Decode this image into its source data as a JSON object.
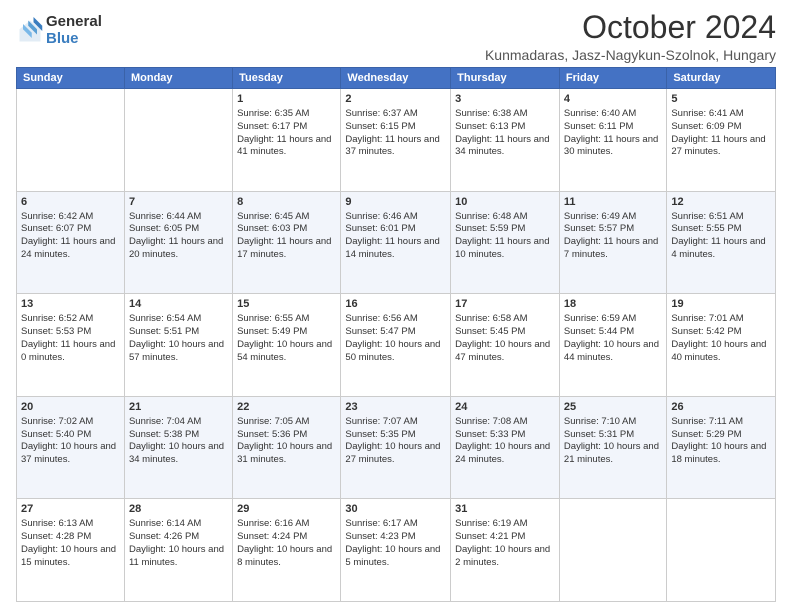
{
  "header": {
    "logo": {
      "general": "General",
      "blue": "Blue"
    },
    "title": "October 2024",
    "subtitle": "Kunmadaras, Jasz-Nagykun-Szolnok, Hungary"
  },
  "weekdays": [
    "Sunday",
    "Monday",
    "Tuesday",
    "Wednesday",
    "Thursday",
    "Friday",
    "Saturday"
  ],
  "weeks": [
    [
      {
        "day": "",
        "sunrise": "",
        "sunset": "",
        "daylight": ""
      },
      {
        "day": "",
        "sunrise": "",
        "sunset": "",
        "daylight": ""
      },
      {
        "day": "1",
        "sunrise": "Sunrise: 6:35 AM",
        "sunset": "Sunset: 6:17 PM",
        "daylight": "Daylight: 11 hours and 41 minutes."
      },
      {
        "day": "2",
        "sunrise": "Sunrise: 6:37 AM",
        "sunset": "Sunset: 6:15 PM",
        "daylight": "Daylight: 11 hours and 37 minutes."
      },
      {
        "day": "3",
        "sunrise": "Sunrise: 6:38 AM",
        "sunset": "Sunset: 6:13 PM",
        "daylight": "Daylight: 11 hours and 34 minutes."
      },
      {
        "day": "4",
        "sunrise": "Sunrise: 6:40 AM",
        "sunset": "Sunset: 6:11 PM",
        "daylight": "Daylight: 11 hours and 30 minutes."
      },
      {
        "day": "5",
        "sunrise": "Sunrise: 6:41 AM",
        "sunset": "Sunset: 6:09 PM",
        "daylight": "Daylight: 11 hours and 27 minutes."
      }
    ],
    [
      {
        "day": "6",
        "sunrise": "Sunrise: 6:42 AM",
        "sunset": "Sunset: 6:07 PM",
        "daylight": "Daylight: 11 hours and 24 minutes."
      },
      {
        "day": "7",
        "sunrise": "Sunrise: 6:44 AM",
        "sunset": "Sunset: 6:05 PM",
        "daylight": "Daylight: 11 hours and 20 minutes."
      },
      {
        "day": "8",
        "sunrise": "Sunrise: 6:45 AM",
        "sunset": "Sunset: 6:03 PM",
        "daylight": "Daylight: 11 hours and 17 minutes."
      },
      {
        "day": "9",
        "sunrise": "Sunrise: 6:46 AM",
        "sunset": "Sunset: 6:01 PM",
        "daylight": "Daylight: 11 hours and 14 minutes."
      },
      {
        "day": "10",
        "sunrise": "Sunrise: 6:48 AM",
        "sunset": "Sunset: 5:59 PM",
        "daylight": "Daylight: 11 hours and 10 minutes."
      },
      {
        "day": "11",
        "sunrise": "Sunrise: 6:49 AM",
        "sunset": "Sunset: 5:57 PM",
        "daylight": "Daylight: 11 hours and 7 minutes."
      },
      {
        "day": "12",
        "sunrise": "Sunrise: 6:51 AM",
        "sunset": "Sunset: 5:55 PM",
        "daylight": "Daylight: 11 hours and 4 minutes."
      }
    ],
    [
      {
        "day": "13",
        "sunrise": "Sunrise: 6:52 AM",
        "sunset": "Sunset: 5:53 PM",
        "daylight": "Daylight: 11 hours and 0 minutes."
      },
      {
        "day": "14",
        "sunrise": "Sunrise: 6:54 AM",
        "sunset": "Sunset: 5:51 PM",
        "daylight": "Daylight: 10 hours and 57 minutes."
      },
      {
        "day": "15",
        "sunrise": "Sunrise: 6:55 AM",
        "sunset": "Sunset: 5:49 PM",
        "daylight": "Daylight: 10 hours and 54 minutes."
      },
      {
        "day": "16",
        "sunrise": "Sunrise: 6:56 AM",
        "sunset": "Sunset: 5:47 PM",
        "daylight": "Daylight: 10 hours and 50 minutes."
      },
      {
        "day": "17",
        "sunrise": "Sunrise: 6:58 AM",
        "sunset": "Sunset: 5:45 PM",
        "daylight": "Daylight: 10 hours and 47 minutes."
      },
      {
        "day": "18",
        "sunrise": "Sunrise: 6:59 AM",
        "sunset": "Sunset: 5:44 PM",
        "daylight": "Daylight: 10 hours and 44 minutes."
      },
      {
        "day": "19",
        "sunrise": "Sunrise: 7:01 AM",
        "sunset": "Sunset: 5:42 PM",
        "daylight": "Daylight: 10 hours and 40 minutes."
      }
    ],
    [
      {
        "day": "20",
        "sunrise": "Sunrise: 7:02 AM",
        "sunset": "Sunset: 5:40 PM",
        "daylight": "Daylight: 10 hours and 37 minutes."
      },
      {
        "day": "21",
        "sunrise": "Sunrise: 7:04 AM",
        "sunset": "Sunset: 5:38 PM",
        "daylight": "Daylight: 10 hours and 34 minutes."
      },
      {
        "day": "22",
        "sunrise": "Sunrise: 7:05 AM",
        "sunset": "Sunset: 5:36 PM",
        "daylight": "Daylight: 10 hours and 31 minutes."
      },
      {
        "day": "23",
        "sunrise": "Sunrise: 7:07 AM",
        "sunset": "Sunset: 5:35 PM",
        "daylight": "Daylight: 10 hours and 27 minutes."
      },
      {
        "day": "24",
        "sunrise": "Sunrise: 7:08 AM",
        "sunset": "Sunset: 5:33 PM",
        "daylight": "Daylight: 10 hours and 24 minutes."
      },
      {
        "day": "25",
        "sunrise": "Sunrise: 7:10 AM",
        "sunset": "Sunset: 5:31 PM",
        "daylight": "Daylight: 10 hours and 21 minutes."
      },
      {
        "day": "26",
        "sunrise": "Sunrise: 7:11 AM",
        "sunset": "Sunset: 5:29 PM",
        "daylight": "Daylight: 10 hours and 18 minutes."
      }
    ],
    [
      {
        "day": "27",
        "sunrise": "Sunrise: 6:13 AM",
        "sunset": "Sunset: 4:28 PM",
        "daylight": "Daylight: 10 hours and 15 minutes."
      },
      {
        "day": "28",
        "sunrise": "Sunrise: 6:14 AM",
        "sunset": "Sunset: 4:26 PM",
        "daylight": "Daylight: 10 hours and 11 minutes."
      },
      {
        "day": "29",
        "sunrise": "Sunrise: 6:16 AM",
        "sunset": "Sunset: 4:24 PM",
        "daylight": "Daylight: 10 hours and 8 minutes."
      },
      {
        "day": "30",
        "sunrise": "Sunrise: 6:17 AM",
        "sunset": "Sunset: 4:23 PM",
        "daylight": "Daylight: 10 hours and 5 minutes."
      },
      {
        "day": "31",
        "sunrise": "Sunrise: 6:19 AM",
        "sunset": "Sunset: 4:21 PM",
        "daylight": "Daylight: 10 hours and 2 minutes."
      },
      {
        "day": "",
        "sunrise": "",
        "sunset": "",
        "daylight": ""
      },
      {
        "day": "",
        "sunrise": "",
        "sunset": "",
        "daylight": ""
      }
    ]
  ]
}
